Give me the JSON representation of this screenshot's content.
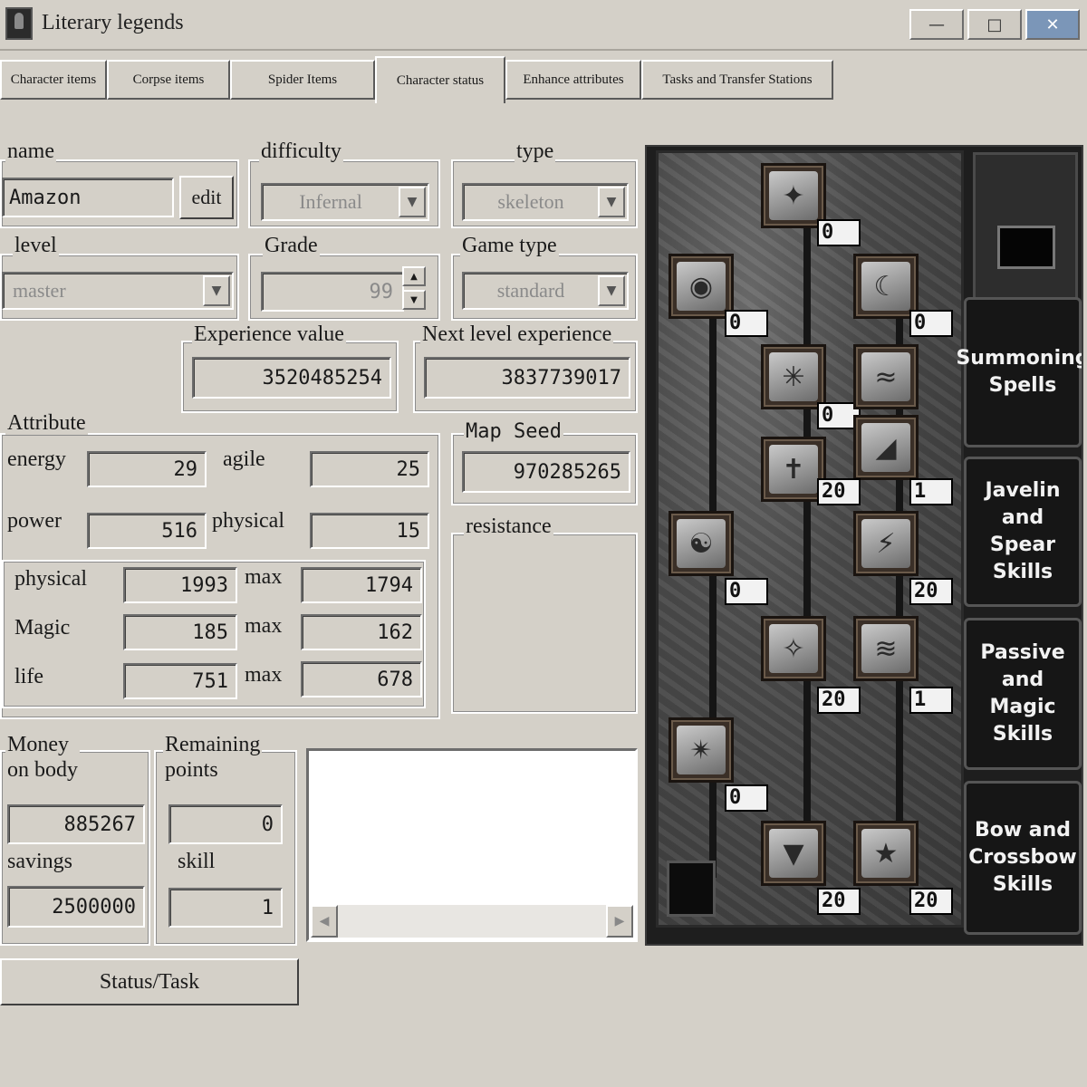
{
  "window": {
    "title": "Literary legends",
    "min_icon": "minimize-icon",
    "max_icon": "maximize-icon",
    "close_icon": "close-icon",
    "close_color": "#7b96b8"
  },
  "tabs": [
    {
      "label": "Character items"
    },
    {
      "label": "Corpse items"
    },
    {
      "label": "Spider Items"
    },
    {
      "label": "Character status"
    },
    {
      "label": "Enhance attributes"
    },
    {
      "label": "Tasks and Transfer Stations"
    }
  ],
  "active_tab": "Character status",
  "name": {
    "label": "name",
    "value": "Amazon",
    "edit_label": "edit"
  },
  "difficulty": {
    "label": "difficulty",
    "value": "Infernal"
  },
  "type": {
    "label": "type",
    "value": "skeleton"
  },
  "level": {
    "label": "level",
    "value": "master"
  },
  "grade": {
    "label": "Grade",
    "value": "99"
  },
  "game_type": {
    "label": "Game type",
    "value": "standard"
  },
  "experience": {
    "label": "Experience value",
    "value": "3520485254"
  },
  "next_experience": {
    "label": "Next level experience",
    "value": "3837739017"
  },
  "attribute": {
    "label": "Attribute",
    "energy_label": "energy",
    "energy": "29",
    "agile_label": "agile",
    "agile": "25",
    "power_label": "power",
    "power": "516",
    "physical_label": "physical",
    "physical": "15"
  },
  "stats": {
    "physical_label": "physical",
    "physical": "1993",
    "physical_max": "1794",
    "magic_label": "Magic",
    "magic": "185",
    "magic_max": "162",
    "life_label": "life",
    "life": "751",
    "life_max": "678",
    "max_label": "max"
  },
  "map_seed": {
    "label": "Map Seed",
    "value": "970285265"
  },
  "resistance": {
    "label": "resistance"
  },
  "money": {
    "label_line1": "Money",
    "label_line2": "on body",
    "value": "885267",
    "savings_label": "savings",
    "savings": "2500000"
  },
  "remaining": {
    "label_line1": "Remaining",
    "label_line2": "points",
    "value": "0",
    "skill_label": "skill",
    "skill": "1"
  },
  "status_button": "Status/Task",
  "skill_tree": {
    "skills": [
      {
        "icon": "fist-skill-icon",
        "points": "0"
      },
      {
        "icon": "eye-skill-icon",
        "points": "0"
      },
      {
        "icon": "moon-skill-icon",
        "points": "0"
      },
      {
        "icon": "spark-skill-icon",
        "points": "0"
      },
      {
        "icon": "wave-skill-icon",
        "points": ""
      },
      {
        "icon": "dagger-skill-icon",
        "points": "20"
      },
      {
        "icon": "stairs-skill-icon",
        "points": "1"
      },
      {
        "icon": "figure-skill-icon",
        "points": "0"
      },
      {
        "icon": "lightning-orb-skill-icon",
        "points": "20"
      },
      {
        "icon": "claw-skill-icon",
        "points": "20"
      },
      {
        "icon": "ripple-skill-icon",
        "points": "1"
      },
      {
        "icon": "starburst-skill-icon",
        "points": "0"
      },
      {
        "icon": "fury-skill-icon",
        "points": "20"
      },
      {
        "icon": "storm-skill-icon",
        "points": "20"
      }
    ],
    "tabs": [
      {
        "label": "Summoning Spells"
      },
      {
        "label": "Javelin and Spear Skills"
      },
      {
        "label": "Passive and Magic Skills"
      },
      {
        "label": "Bow and Crossbow Skills"
      }
    ]
  }
}
